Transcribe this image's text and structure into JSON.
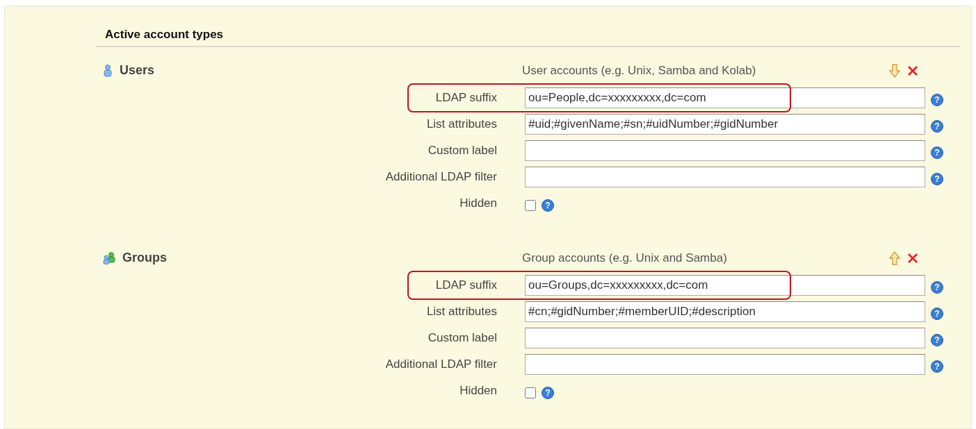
{
  "section_title": "Active account types",
  "account_types": [
    {
      "name": "Users",
      "description": "User accounts (e.g. Unix, Samba and Kolab)",
      "fields": [
        {
          "kind": "text",
          "label": "LDAP suffix",
          "value": "ou=People,dc=xxxxxxxxx,dc=com",
          "help": "?",
          "highlighted": true
        },
        {
          "kind": "text",
          "label": "List attributes",
          "value": "#uid;#givenName;#sn;#uidNumber;#gidNumber",
          "help": "?",
          "highlighted": false
        },
        {
          "kind": "text",
          "label": "Custom label",
          "help": "?",
          "highlighted": false
        },
        {
          "kind": "text",
          "label": "Additional LDAP filter",
          "help": "?",
          "highlighted": false
        },
        {
          "kind": "checkbox",
          "label": "Hidden",
          "checked": false,
          "help": "?",
          "highlighted": false
        }
      ]
    },
    {
      "name": "Groups",
      "description": "Group accounts (e.g. Unix and Samba)",
      "fields": [
        {
          "kind": "text",
          "label": "LDAP suffix",
          "value": "ou=Groups,dc=xxxxxxxxx,dc=com",
          "help": "?",
          "highlighted": true
        },
        {
          "kind": "text",
          "label": "List attributes",
          "value": "#cn;#gidNumber;#memberUID;#description",
          "help": "?",
          "highlighted": false
        },
        {
          "kind": "text",
          "label": "Custom label",
          "help": "?",
          "highlighted": false
        },
        {
          "kind": "text",
          "label": "Additional LDAP filter",
          "help": "?",
          "highlighted": false
        },
        {
          "kind": "checkbox",
          "label": "Hidden",
          "checked": false,
          "help": "?",
          "highlighted": false
        }
      ]
    }
  ]
}
